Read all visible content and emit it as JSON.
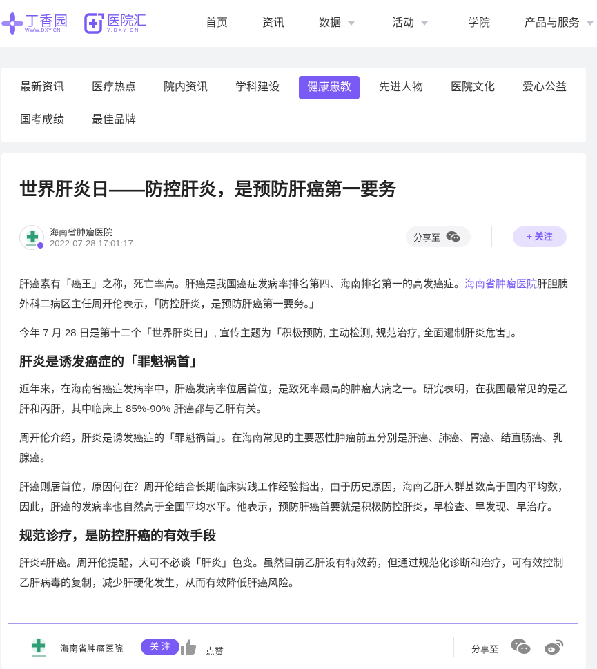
{
  "header": {
    "logo1": {
      "name": "丁香园",
      "url": "WWW.DXY.CN"
    },
    "logo2": {
      "name": "医院汇",
      "url": "Y.DXY.CN"
    },
    "nav": [
      {
        "label": "首页"
      },
      {
        "label": "资讯"
      },
      {
        "label": "数据"
      },
      {
        "label": "活动"
      },
      {
        "label": "学院"
      },
      {
        "label": "产品与服务"
      }
    ]
  },
  "categories": {
    "items": [
      "最新资讯",
      "医疗热点",
      "院内资讯",
      "学科建设",
      "健康患教",
      "先进人物",
      "医院文化",
      "爱心公益",
      "国考成绩",
      "最佳品牌"
    ],
    "active": "健康患教"
  },
  "article": {
    "title": "世界肝炎日——防控肝炎，是预防肝癌第一要务",
    "author": "海南省肿瘤医院",
    "date": "2022-07-28 17:01:17",
    "share_label": "分享至",
    "follow_label": "+ 关注",
    "p1_a": "肝癌素有「癌王」之称，死亡率高。肝癌是我国癌症发病率排名第四、海南排名第一的高发癌症。",
    "p1_link": "海南省肿瘤医院",
    "p1_b": "肝胆胰外科二病区主任周开伦表示，「防控肝炎，是预防肝癌第一要务。」",
    "p2": "今年 7 月 28 日是第十二个「世界肝炎日」, 宣传主题为「积极预防, 主动检测, 规范治疗, 全面遏制肝炎危害」。",
    "h1": "肝炎是诱发癌症的「罪魁祸首」",
    "p3": "近年来，在海南省癌症发病率中，肝癌发病率位居首位，是致死率最高的肿瘤大病之一。研究表明，在我国最常见的是乙肝和丙肝，其中临床上 85%-90% 肝癌都与乙肝有关。",
    "p4": "周开伦介绍，肝炎是诱发癌症的「罪魁祸首」。在海南常见的主要恶性肿瘤前五分别是肝癌、肺癌、胃癌、结直肠癌、乳腺癌。",
    "p5": "肝癌则居首位，原因何在？周开伦结合长期临床实践工作经验指出，由于历史原因，海南乙肝人群基数高于国内平均数，因此，肝癌的发病率也自然高于全国平均水平。他表示，预防肝癌首要就是积极防控肝炎，早检查、早发现、早治疗。",
    "h2": "规范诊疗，是防控肝癌的有效手段",
    "p6": "肝炎≠肝癌。周开伦提醒，大可不必谈「肝炎」色变。虽然目前乙肝没有特效药，但通过规范化诊断和治疗，可有效控制乙肝病毒的复制，减少肝硬化发生，从而有效降低肝癌风险。"
  },
  "bottombar": {
    "name": "海南省肿瘤医院",
    "follow_label": "关 注",
    "like_label": "点赞",
    "share_label": "分享至"
  },
  "colors": {
    "accent": "#7a5af5",
    "accent_light": "#e7e1fd"
  },
  "icons": [
    "dxy-flower-logo",
    "hospital-hui-logo",
    "chevron-down-icon",
    "wechat-icon",
    "thumb-up-icon",
    "weibo-icon",
    "verified-badge-icon"
  ]
}
